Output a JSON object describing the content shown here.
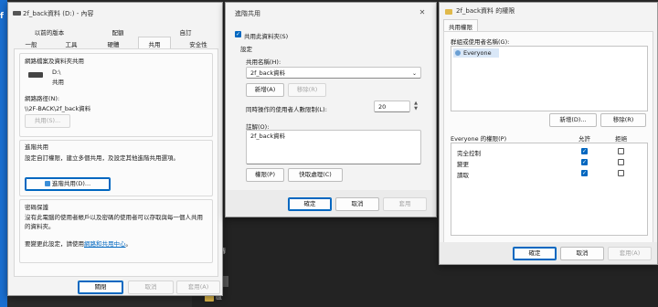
{
  "background": {
    "blue_edge": "#1a6fd1",
    "dark": "#2b2b2b"
  },
  "props": {
    "title": "2f_back資料 (D:) - 內容",
    "tabs_row1": [
      "以前的版本",
      "配額",
      "自訂"
    ],
    "tabs_row2": [
      "一般",
      "工具",
      "硬體",
      "共用",
      "安全性"
    ],
    "section1_title": "網路檔案及資料夾共用",
    "drive_name": "D:\\",
    "drive_status": "共用",
    "path_label": "網路路徑(N):",
    "path_value": "\\\\2F-BACK\\2f_back資料",
    "share_btn": "共用(S)...",
    "section2_title": "進階共用",
    "section2_desc": "設定自訂權限，建立多個共用，及設定其他進階共用選項。",
    "advanced_btn": "進階共用(D)...",
    "section3_title": "密碼保護",
    "section3_desc": "沒有此電腦的使用者帳戶以及密碼的使用者可以存取與每一個人共用的資料夾。",
    "section3_change_prefix": "要變更此設定，請使用",
    "section3_link": "網路和共用中心",
    "section3_change_suffix": "。",
    "ok": "關閉",
    "cancel": "取消",
    "apply": "套用(A)"
  },
  "adv": {
    "title": "進階共用",
    "share_check": "共用此資料夾(S)",
    "settings_label": "設定",
    "share_name_label": "共用名稱(H):",
    "share_name_value": "2f_back資料",
    "add_btn": "新增(A)",
    "remove_btn": "移除(R)",
    "limit_label": "同時操作的使用者人數限制(L):",
    "limit_value": "20",
    "comment_label": "註解(O):",
    "comment_value": "2f_back資料",
    "perm_btn": "權限(P)",
    "cache_btn": "快取處理(C)",
    "ok": "確定",
    "cancel": "取消",
    "apply": "套用"
  },
  "perm": {
    "title": "2f_back資料 的權限",
    "tab": "共用權限",
    "group_label": "群組或使用者名稱(G):",
    "users": [
      "Everyone"
    ],
    "add_btn": "新增(D)...",
    "remove_btn": "移除(R)",
    "perm_label": "Everyone 的權限(P)",
    "allow_col": "允許",
    "deny_col": "拒絕",
    "rows": [
      {
        "name": "完全控制",
        "allow": true,
        "deny": false
      },
      {
        "name": "變更",
        "allow": true,
        "deny": false
      },
      {
        "name": "讀取",
        "allow": true,
        "deny": false
      }
    ],
    "ok": "確定",
    "cancel": "取消",
    "apply": "套用(A)"
  },
  "desktop": {
    "label1": "區",
    "label2": "傳"
  }
}
